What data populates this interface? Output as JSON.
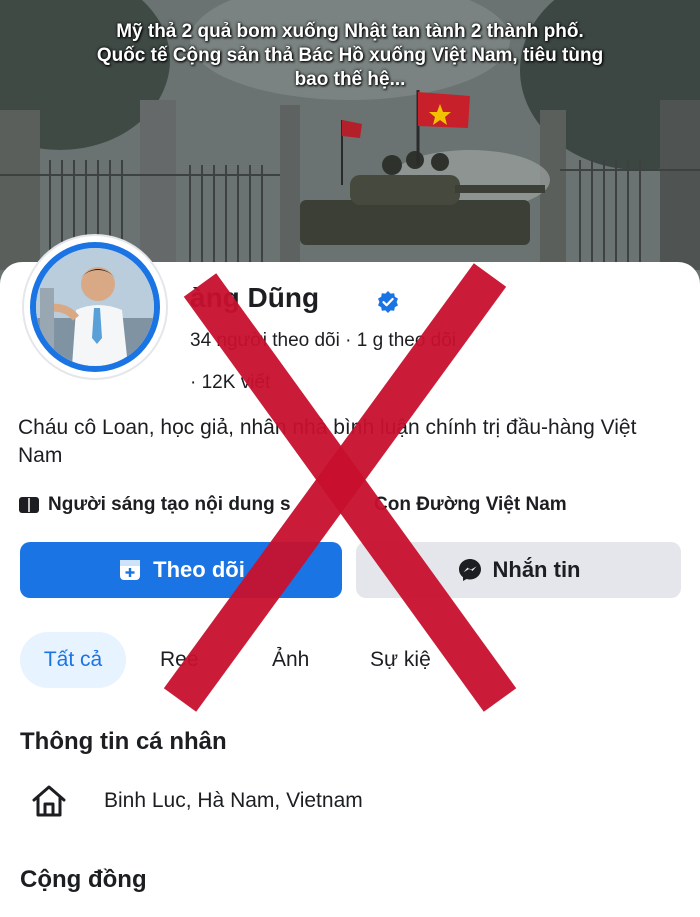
{
  "cover": {
    "caption_line1": "Mỹ thả 2 quả bom xuống Nhật tan tành 2 thành phố.",
    "caption_line2": "Quốc tế Cộng sản thả Bác Hồ xuống Việt Nam, tiêu tùng",
    "caption_line3": "bao thế hệ..."
  },
  "profile": {
    "name": "àng Dũng",
    "followers_line": "34   người theo dõi · 1      g theo dõi",
    "posts_line": "· 12K      viết",
    "bio": "Cháu cô Loan, học giả,      nhân    nhà bình luận chính trị đầu-hàng Việt Nam",
    "creator_left": "Người sáng tạo nội dung s",
    "creator_right": "Con Đường Việt Nam"
  },
  "actions": {
    "follow_label": "Theo dõi",
    "message_label": "Nhắn tin"
  },
  "tabs": [
    "Tất cả",
    "Ree",
    "Ảnh",
    "Sự kiệ"
  ],
  "sections": {
    "personal_info_title": "Thông tin cá nhân",
    "location": "Binh Luc, Hà Nam, Vietnam",
    "community_title": "Cộng đồng"
  },
  "colors": {
    "accent": "#1b74e4",
    "overlay_x": "#c8102e"
  },
  "icons": [
    "verified-badge-icon",
    "book-icon",
    "follow-plus-icon",
    "messenger-icon",
    "home-icon",
    "cross-mark-overlay"
  ]
}
